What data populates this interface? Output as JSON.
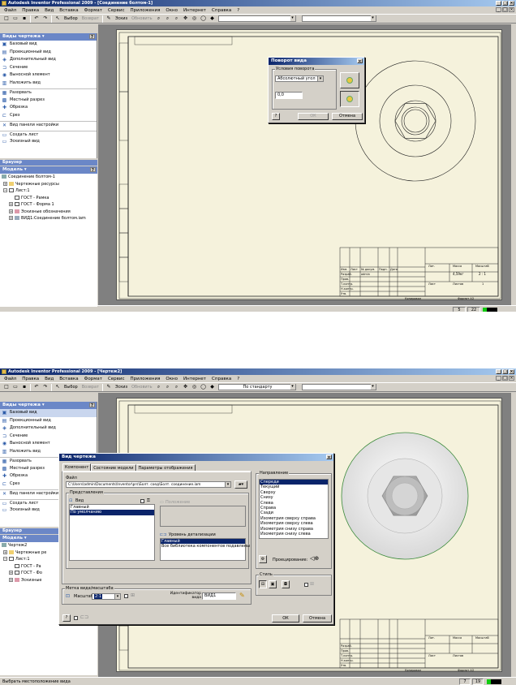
{
  "shot1": {
    "title": "Autodesk Inventor Professional 2009 - [Соединение болтом-1]",
    "menu": [
      "Файл",
      "Правка",
      "Вид",
      "Вставка",
      "Формат",
      "Сервис",
      "Приложения",
      "Окно",
      "Интернет",
      "Справка"
    ],
    "toolbar": {
      "select_label": "Выбор",
      "return_label": "Возврат",
      "sketch_label": "Эскиз",
      "update_label": "Обновить"
    },
    "panel_title": "Виды чертежа",
    "panel_items": [
      "Базовый вид",
      "Проекционный вид",
      "Дополнительный вид",
      "Сечение",
      "Выносной элемент",
      "Наложить вид",
      "Разорвать",
      "Местный разрез",
      "Обрезка",
      "Срез",
      "Вид панели настройки",
      "Создать лист",
      "Эскизный вид"
    ],
    "browser_label": "Браузер",
    "model_title": "Модель",
    "tree": [
      "Соединение болтом-1",
      "Чертежные ресурсы",
      "Лист:1",
      "ГОСТ - Рамка",
      "ГОСТ - Форма 1",
      "Эскизные обозначения",
      "ВИД1:Соединение болтом.iam"
    ],
    "dialog": {
      "title": "Поворот вида",
      "group_label": "Условия поворота",
      "angle_mode": "Абсолютный угол",
      "angle_value": "0,0",
      "ok": "ОК",
      "cancel": "Отмена"
    },
    "status": {
      "a": "5",
      "b": "22"
    },
    "titleblock": {
      "col1": "Изм.",
      "col2": "Лист",
      "col3": "№ докум.",
      "col4": "Подп.",
      "col5": "Дата",
      "r1": "Разраб.",
      "r1b": "admin",
      "r2": "Пров.",
      "r3": "Т.контр.",
      "r4": "Н.контр.",
      "r5": "Утв.",
      "lit": "Лит.",
      "mass": "Масса",
      "scale": "Масштаб",
      "scale_val": "2 : 1",
      "mass_val": "4,59кг",
      "sheet": "Лист",
      "sheets": "Листов",
      "sheets_val": "1",
      "copied": "Копировал",
      "format": "Формат А3"
    }
  },
  "shot2": {
    "title": "Autodesk Inventor Professional 2009 - [Чертеж2]",
    "menu": [
      "Файл",
      "Правка",
      "Вид",
      "Вставка",
      "Формат",
      "Сервис",
      "Приложения",
      "Окно",
      "Интернет",
      "Справка"
    ],
    "toolbar": {
      "select_label": "Выбор",
      "return_label": "Возврат",
      "sketch_label": "Эскиз",
      "update_label": "Обновить",
      "style_combo": "По стандарту"
    },
    "panel_title": "Виды чертежа",
    "panel_items": [
      "Базовый вид",
      "Проекционный вид",
      "Дополнительный вид",
      "Сечение",
      "Выносной элемент",
      "Наложить вид",
      "Разорвать",
      "Местный разрез",
      "Обрезка",
      "Срез",
      "Вид панели настройки",
      "Создать лист",
      "Эскизный вид"
    ],
    "browser_label": "Браузер",
    "model_title": "Модель",
    "tree": [
      "Чертеж2",
      "Чертежные ре",
      "Лист:1",
      "ГОСТ - Ра",
      "ГОСТ - Фо",
      "Эскизные"
    ],
    "dialog": {
      "title": "Вид чертежа",
      "tabs": [
        "Компонент",
        "Состояние модели",
        "Параметры отображения"
      ],
      "file_label": "Файл",
      "file_path": "C:\\Users\\admin\\Documents\\Inventor\\prs\\Болт. соед\\Болт. соединение.iam",
      "representation_label": "Представления",
      "view_label": "Вид",
      "view_items": [
        "Главный",
        "По умолчанию"
      ],
      "position_label": "Положение",
      "detail_level_label": "Уровень детализации",
      "detail_items": [
        "Главный",
        "Все библиотека компонентов подавлены"
      ],
      "direction_label": "Направление",
      "direction_items": [
        "Спереди",
        "Текущий",
        "Сверху",
        "Снизу",
        "Слева",
        "Справа",
        "Сзади",
        "Изометрия сверху справа",
        "Изометрия сверху слева",
        "Изометрия снизу справа",
        "Изометрия снизу слева"
      ],
      "projection_label": "Проецирование:",
      "style_label": "Стиль",
      "scale_group": "Метка вида/масштаба",
      "scale_label": "Масштаб",
      "scale_value": "2:1",
      "id_label": "Идентификатор вида",
      "id_value": "ВИД1",
      "ok": "ОК",
      "cancel": "Отмена"
    },
    "status_text": "Выбрать местоположение вида",
    "status": {
      "a": "7",
      "b": "19"
    },
    "titleblock": {
      "mass": "Масса",
      "scale": "Масштаб",
      "sheet": "Лист",
      "sheets": "Листов",
      "copied": "Копировал",
      "format": "Формат А3",
      "r1": "Разраб.",
      "r2": "Пров.",
      "r3": "Т.контр.",
      "r4": "Н.контр.",
      "r5": "Утв.",
      "lit": "Лит."
    }
  }
}
